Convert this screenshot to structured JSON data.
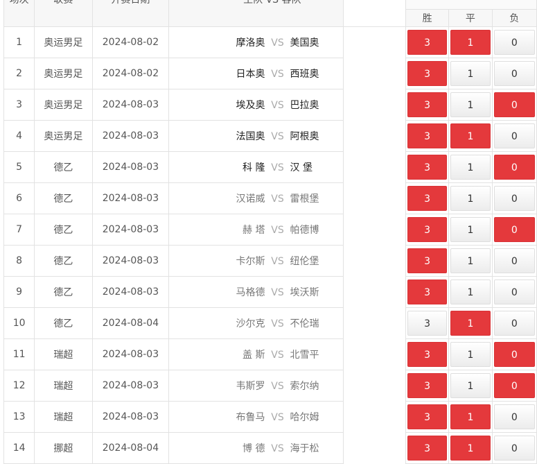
{
  "header": {
    "col_no": "场次",
    "col_league": "联赛",
    "col_date": "开赛日期",
    "col_match": "主队 VS 客队",
    "opt_win": "胜",
    "opt_draw": "平",
    "opt_lose": "负"
  },
  "vs_label": "VS",
  "matches": [
    {
      "no": "1",
      "league": "奥运男足",
      "date": "2024-08-02",
      "home": "摩洛奥",
      "away": "美国奥",
      "win": "3",
      "draw": "1",
      "lose": "0",
      "sel": [
        true,
        true,
        false
      ],
      "dim": false
    },
    {
      "no": "2",
      "league": "奥运男足",
      "date": "2024-08-02",
      "home": "日本奥",
      "away": "西班奥",
      "win": "3",
      "draw": "1",
      "lose": "0",
      "sel": [
        true,
        false,
        false
      ],
      "dim": false
    },
    {
      "no": "3",
      "league": "奥运男足",
      "date": "2024-08-03",
      "home": "埃及奥",
      "away": "巴拉奥",
      "win": "3",
      "draw": "1",
      "lose": "0",
      "sel": [
        true,
        false,
        true
      ],
      "dim": false
    },
    {
      "no": "4",
      "league": "奥运男足",
      "date": "2024-08-03",
      "home": "法国奥",
      "away": "阿根奥",
      "win": "3",
      "draw": "1",
      "lose": "0",
      "sel": [
        true,
        true,
        false
      ],
      "dim": false
    },
    {
      "no": "5",
      "league": "德乙",
      "date": "2024-08-03",
      "home": "科 隆",
      "away": "汉 堡",
      "win": "3",
      "draw": "1",
      "lose": "0",
      "sel": [
        true,
        false,
        true
      ],
      "dim": false
    },
    {
      "no": "6",
      "league": "德乙",
      "date": "2024-08-03",
      "home": "汉诺威",
      "away": "雷根堡",
      "win": "3",
      "draw": "1",
      "lose": "0",
      "sel": [
        true,
        false,
        false
      ],
      "dim": true
    },
    {
      "no": "7",
      "league": "德乙",
      "date": "2024-08-03",
      "home": "赫 塔",
      "away": "帕德博",
      "win": "3",
      "draw": "1",
      "lose": "0",
      "sel": [
        true,
        false,
        true
      ],
      "dim": true
    },
    {
      "no": "8",
      "league": "德乙",
      "date": "2024-08-03",
      "home": "卡尔斯",
      "away": "纽伦堡",
      "win": "3",
      "draw": "1",
      "lose": "0",
      "sel": [
        true,
        false,
        false
      ],
      "dim": true
    },
    {
      "no": "9",
      "league": "德乙",
      "date": "2024-08-03",
      "home": "马格德",
      "away": "埃沃斯",
      "win": "3",
      "draw": "1",
      "lose": "0",
      "sel": [
        true,
        false,
        false
      ],
      "dim": true
    },
    {
      "no": "10",
      "league": "德乙",
      "date": "2024-08-04",
      "home": "沙尔克",
      "away": "不伦瑞",
      "win": "3",
      "draw": "1",
      "lose": "0",
      "sel": [
        false,
        true,
        false
      ],
      "dim": true
    },
    {
      "no": "11",
      "league": "瑞超",
      "date": "2024-08-03",
      "home": "盖 斯",
      "away": "北雪平",
      "win": "3",
      "draw": "1",
      "lose": "0",
      "sel": [
        true,
        false,
        true
      ],
      "dim": true
    },
    {
      "no": "12",
      "league": "瑞超",
      "date": "2024-08-03",
      "home": "韦斯罗",
      "away": "索尔纳",
      "win": "3",
      "draw": "1",
      "lose": "0",
      "sel": [
        true,
        false,
        true
      ],
      "dim": true
    },
    {
      "no": "13",
      "league": "瑞超",
      "date": "2024-08-03",
      "home": "布鲁马",
      "away": "哈尔姆",
      "win": "3",
      "draw": "1",
      "lose": "0",
      "sel": [
        true,
        true,
        false
      ],
      "dim": true
    },
    {
      "no": "14",
      "league": "挪超",
      "date": "2024-08-04",
      "home": "博 德",
      "away": "海于松",
      "win": "3",
      "draw": "1",
      "lose": "0",
      "sel": [
        true,
        true,
        false
      ],
      "dim": true
    }
  ]
}
